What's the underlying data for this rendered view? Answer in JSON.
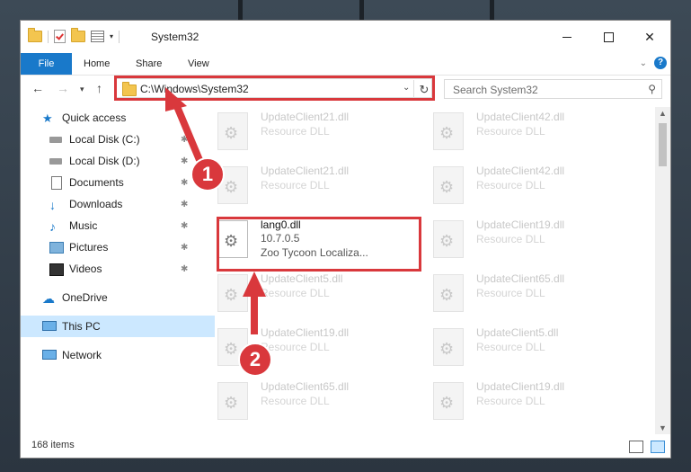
{
  "window": {
    "title": "System32",
    "controls": {
      "minimize": "—",
      "maximize": "☐",
      "close": "✕"
    }
  },
  "ribbon": {
    "tabs": [
      {
        "label": "File"
      },
      {
        "label": "Share"
      },
      {
        "label": "View"
      }
    ],
    "home_label": "Home"
  },
  "address_bar": {
    "path": "C:\\Windows\\System32",
    "dropdown_icon": "chevron-down-icon",
    "refresh_icon": "refresh-icon"
  },
  "search": {
    "placeholder": "Search System32"
  },
  "sidebar": {
    "quick_access": "Quick access",
    "items": [
      {
        "label": "Local Disk (C:)",
        "icon": "drive-icon",
        "pinned": true
      },
      {
        "label": "Local Disk (D:)",
        "icon": "drive-icon",
        "pinned": true
      },
      {
        "label": "Documents",
        "icon": "documents-icon",
        "pinned": true
      },
      {
        "label": "Downloads",
        "icon": "downloads-icon",
        "pinned": true
      },
      {
        "label": "Music",
        "icon": "music-icon",
        "pinned": true
      },
      {
        "label": "Pictures",
        "icon": "pictures-icon",
        "pinned": true
      },
      {
        "label": "Videos",
        "icon": "videos-icon",
        "pinned": true
      }
    ],
    "onedrive": "OneDrive",
    "this_pc": "This PC",
    "network": "Network"
  },
  "files": {
    "left": [
      {
        "name": "UpdateClient21.dll",
        "type": "Resource DLL"
      },
      {
        "name": "UpdateClient21.dll",
        "type": "Resource DLL"
      },
      {
        "name": "lang0.dll",
        "type": "10.7.0.5",
        "sub": "Zoo Tycoon Localiza..."
      },
      {
        "name": "UpdateClient5.dll",
        "type": "Resource DLL"
      },
      {
        "name": "UpdateClient19.dll",
        "type": "Resource DLL"
      },
      {
        "name": "UpdateClient65.dll",
        "type": "Resource DLL"
      }
    ],
    "right": [
      {
        "name": "UpdateClient42.dll",
        "type": "Resource DLL"
      },
      {
        "name": "UpdateClient42.dll",
        "type": "Resource DLL"
      },
      {
        "name": "UpdateClient19.dll",
        "type": "Resource DLL"
      },
      {
        "name": "UpdateClient65.dll",
        "type": "Resource DLL"
      },
      {
        "name": "UpdateClient5.dll",
        "type": "Resource DLL"
      },
      {
        "name": "UpdateClient19.dll",
        "type": "Resource DLL"
      }
    ]
  },
  "status": {
    "item_count": "168 items"
  },
  "callouts": {
    "one": "1",
    "two": "2"
  },
  "colors": {
    "accent": "#1979ca",
    "highlight": "#d9383c",
    "selection": "#cce8ff"
  }
}
